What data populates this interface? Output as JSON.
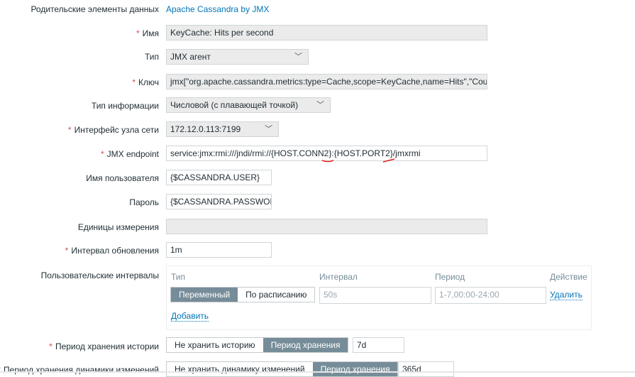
{
  "form": {
    "parent": {
      "label": "Родительские элементы данных",
      "value": "Apache Cassandra by JMX"
    },
    "name": {
      "label": "Имя",
      "value": "KeyCache: Hits per second"
    },
    "type": {
      "label": "Тип",
      "value": "JMX агент"
    },
    "key": {
      "label": "Ключ",
      "value": "jmx[\"org.apache.cassandra.metrics:type=Cache,scope=KeyCache,name=Hits\",\"Count\"]"
    },
    "info_type": {
      "label": "Тип информации",
      "value": "Числовой (с плавающей точкой)"
    },
    "interface": {
      "label": "Интерфейс узла сети",
      "value": "172.12.0.113:7199"
    },
    "jmx_endpoint": {
      "label": "JMX endpoint",
      "value": "service:jmx:rmi:///jndi/rmi://{HOST.CONN2}:{HOST.PORT2}/jmxrmi"
    },
    "username": {
      "label": "Имя пользователя",
      "value": "{$CASSANDRA.USER}"
    },
    "password": {
      "label": "Пароль",
      "value": "{$CASSANDRA.PASSWORD}"
    },
    "units": {
      "label": "Единицы измерения",
      "value": ""
    },
    "update_interval": {
      "label": "Интервал обновления",
      "value": "1m"
    },
    "custom_intervals": {
      "label": "Пользовательские интервалы",
      "headers": [
        "Тип",
        "Интервал",
        "Период",
        "Действие"
      ],
      "type_options": [
        "Переменный",
        "По расписанию"
      ],
      "interval_placeholder": "50s",
      "period_placeholder": "1-7,00:00-24:00",
      "remove": "Удалить",
      "add": "Добавить"
    },
    "history": {
      "label": "Период хранения истории",
      "options": [
        "Не хранить историю",
        "Период хранения"
      ],
      "value": "7d"
    },
    "trends": {
      "label": "Период хранения динамики изменений",
      "options": [
        "Не хранить динамику изменений",
        "Период хранения"
      ],
      "value": "365d"
    }
  },
  "colors": {
    "accent": "#0275b8",
    "required": "#d64e4e",
    "segment_active": "#768d99",
    "annotation": "#e02020"
  }
}
